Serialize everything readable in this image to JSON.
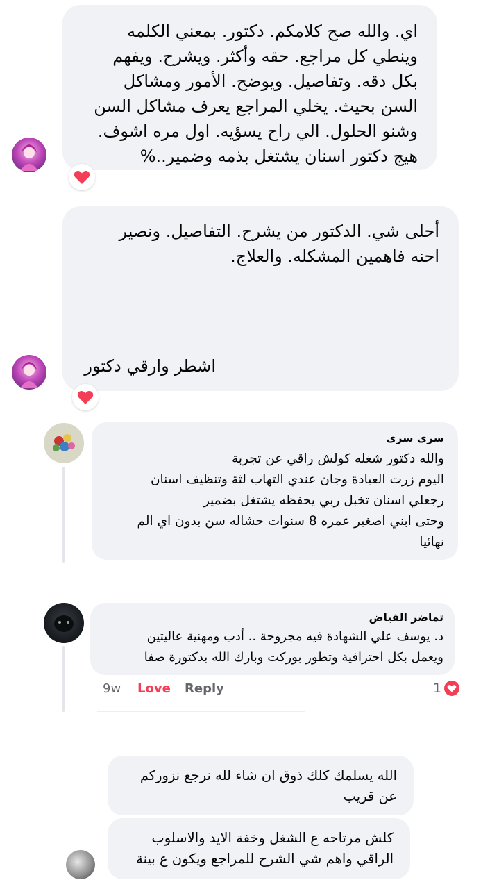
{
  "comments": [
    {
      "text": "اي. والله صح كلامكم.   دكتور.   بمعني الكلمه\nوينطي كل مراجع.  حقه وأكثر.   ويشرح.  ويفهم\nبكل دقه. وتفاصيل. ويوضح.  الأمور ومشاكل\nالسن  بحيث. يخلي المراجع يعرف مشاكل السن\nوشنو الحلول.  الي راح يسؤيه.   اول مره اشوف.\nهيج دكتور اسنان   يشتغل  بذمه وضمير..%",
      "avatar_icon": "anime-girl-avatar",
      "reaction_icon": "heart-icon"
    },
    {
      "text": "أحلى شي. الدكتور  من يشرح.  التفاصيل.  ونصير\nاحنه فاهمين المشكله.  والعلاج.",
      "text_bottom": "اشطر  وارقي دكتور",
      "avatar_icon": "anime-girl-avatar",
      "reaction_icon": "heart-icon"
    }
  ],
  "replies": [
    {
      "name": "سرى سرى",
      "text": "والله دكتور شغله كولش راقي عن تجربة\nاليوم زرت العيادة وجان عندي التهاب لثة وتنظيف اسنان\nرجعلي اسنان تخبل  ربي يحفظه يشتغل بضمير\nوحتى ابني اصغير عمره 8 سنوات حشاله سن بدون اي الم\nنهائيا",
      "avatar_icon": "flowers-avatar"
    },
    {
      "name": "تماضر الفياض",
      "text": "د. يوسف علي  الشهادة فيه مجروحة .. أدب ومهنية عاليتين\nويعمل بكل احترافية وتطور بوركت وبارك الله بدكتورة صفا",
      "avatar_icon": "black-panther-avatar",
      "time": "9w",
      "love_label": "Love",
      "reply_label": "Reply",
      "reaction_count": "1"
    }
  ],
  "bottom_comments": [
    {
      "text": "الله يسلمك كلك ذوق ان شاء لله نرجع نزوركم\nعن قريب"
    },
    {
      "text": "كلش مرتاحه ع الشغل وخفة الايد والاسلوب\nالراقي واهم شي الشرح للمراجع ويكون ع بينة",
      "avatar_icon": "gray-avatar"
    }
  ],
  "colors": {
    "bubble": "#f0f2f5",
    "love": "#f33e58",
    "meta": "#65676b"
  }
}
